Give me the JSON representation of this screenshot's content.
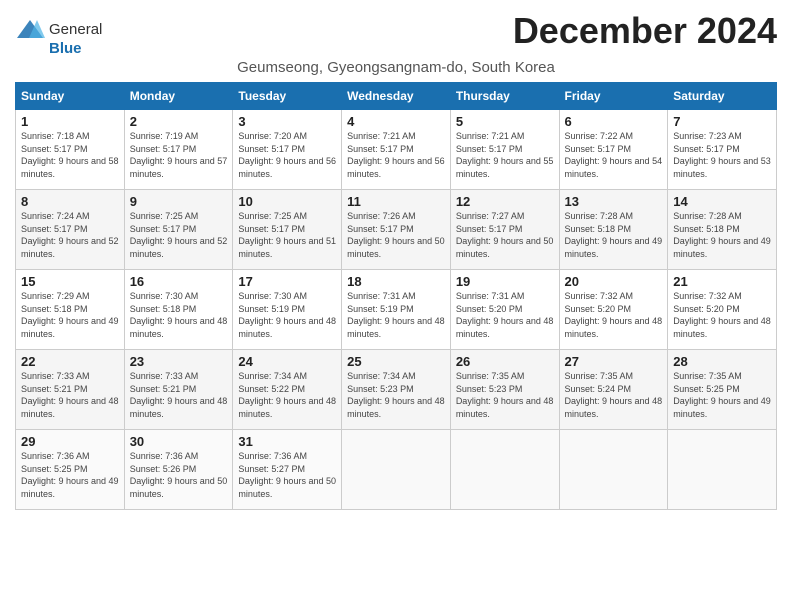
{
  "header": {
    "logo_general": "General",
    "logo_blue": "Blue",
    "month_title": "December 2024",
    "location": "Geumseong, Gyeongsangnam-do, South Korea"
  },
  "weekdays": [
    "Sunday",
    "Monday",
    "Tuesday",
    "Wednesday",
    "Thursday",
    "Friday",
    "Saturday"
  ],
  "weeks": [
    [
      {
        "day": "1",
        "sunrise": "Sunrise: 7:18 AM",
        "sunset": "Sunset: 5:17 PM",
        "daylight": "Daylight: 9 hours and 58 minutes."
      },
      {
        "day": "2",
        "sunrise": "Sunrise: 7:19 AM",
        "sunset": "Sunset: 5:17 PM",
        "daylight": "Daylight: 9 hours and 57 minutes."
      },
      {
        "day": "3",
        "sunrise": "Sunrise: 7:20 AM",
        "sunset": "Sunset: 5:17 PM",
        "daylight": "Daylight: 9 hours and 56 minutes."
      },
      {
        "day": "4",
        "sunrise": "Sunrise: 7:21 AM",
        "sunset": "Sunset: 5:17 PM",
        "daylight": "Daylight: 9 hours and 56 minutes."
      },
      {
        "day": "5",
        "sunrise": "Sunrise: 7:21 AM",
        "sunset": "Sunset: 5:17 PM",
        "daylight": "Daylight: 9 hours and 55 minutes."
      },
      {
        "day": "6",
        "sunrise": "Sunrise: 7:22 AM",
        "sunset": "Sunset: 5:17 PM",
        "daylight": "Daylight: 9 hours and 54 minutes."
      },
      {
        "day": "7",
        "sunrise": "Sunrise: 7:23 AM",
        "sunset": "Sunset: 5:17 PM",
        "daylight": "Daylight: 9 hours and 53 minutes."
      }
    ],
    [
      {
        "day": "8",
        "sunrise": "Sunrise: 7:24 AM",
        "sunset": "Sunset: 5:17 PM",
        "daylight": "Daylight: 9 hours and 52 minutes."
      },
      {
        "day": "9",
        "sunrise": "Sunrise: 7:25 AM",
        "sunset": "Sunset: 5:17 PM",
        "daylight": "Daylight: 9 hours and 52 minutes."
      },
      {
        "day": "10",
        "sunrise": "Sunrise: 7:25 AM",
        "sunset": "Sunset: 5:17 PM",
        "daylight": "Daylight: 9 hours and 51 minutes."
      },
      {
        "day": "11",
        "sunrise": "Sunrise: 7:26 AM",
        "sunset": "Sunset: 5:17 PM",
        "daylight": "Daylight: 9 hours and 50 minutes."
      },
      {
        "day": "12",
        "sunrise": "Sunrise: 7:27 AM",
        "sunset": "Sunset: 5:17 PM",
        "daylight": "Daylight: 9 hours and 50 minutes."
      },
      {
        "day": "13",
        "sunrise": "Sunrise: 7:28 AM",
        "sunset": "Sunset: 5:18 PM",
        "daylight": "Daylight: 9 hours and 49 minutes."
      },
      {
        "day": "14",
        "sunrise": "Sunrise: 7:28 AM",
        "sunset": "Sunset: 5:18 PM",
        "daylight": "Daylight: 9 hours and 49 minutes."
      }
    ],
    [
      {
        "day": "15",
        "sunrise": "Sunrise: 7:29 AM",
        "sunset": "Sunset: 5:18 PM",
        "daylight": "Daylight: 9 hours and 49 minutes."
      },
      {
        "day": "16",
        "sunrise": "Sunrise: 7:30 AM",
        "sunset": "Sunset: 5:18 PM",
        "daylight": "Daylight: 9 hours and 48 minutes."
      },
      {
        "day": "17",
        "sunrise": "Sunrise: 7:30 AM",
        "sunset": "Sunset: 5:19 PM",
        "daylight": "Daylight: 9 hours and 48 minutes."
      },
      {
        "day": "18",
        "sunrise": "Sunrise: 7:31 AM",
        "sunset": "Sunset: 5:19 PM",
        "daylight": "Daylight: 9 hours and 48 minutes."
      },
      {
        "day": "19",
        "sunrise": "Sunrise: 7:31 AM",
        "sunset": "Sunset: 5:20 PM",
        "daylight": "Daylight: 9 hours and 48 minutes."
      },
      {
        "day": "20",
        "sunrise": "Sunrise: 7:32 AM",
        "sunset": "Sunset: 5:20 PM",
        "daylight": "Daylight: 9 hours and 48 minutes."
      },
      {
        "day": "21",
        "sunrise": "Sunrise: 7:32 AM",
        "sunset": "Sunset: 5:20 PM",
        "daylight": "Daylight: 9 hours and 48 minutes."
      }
    ],
    [
      {
        "day": "22",
        "sunrise": "Sunrise: 7:33 AM",
        "sunset": "Sunset: 5:21 PM",
        "daylight": "Daylight: 9 hours and 48 minutes."
      },
      {
        "day": "23",
        "sunrise": "Sunrise: 7:33 AM",
        "sunset": "Sunset: 5:21 PM",
        "daylight": "Daylight: 9 hours and 48 minutes."
      },
      {
        "day": "24",
        "sunrise": "Sunrise: 7:34 AM",
        "sunset": "Sunset: 5:22 PM",
        "daylight": "Daylight: 9 hours and 48 minutes."
      },
      {
        "day": "25",
        "sunrise": "Sunrise: 7:34 AM",
        "sunset": "Sunset: 5:23 PM",
        "daylight": "Daylight: 9 hours and 48 minutes."
      },
      {
        "day": "26",
        "sunrise": "Sunrise: 7:35 AM",
        "sunset": "Sunset: 5:23 PM",
        "daylight": "Daylight: 9 hours and 48 minutes."
      },
      {
        "day": "27",
        "sunrise": "Sunrise: 7:35 AM",
        "sunset": "Sunset: 5:24 PM",
        "daylight": "Daylight: 9 hours and 48 minutes."
      },
      {
        "day": "28",
        "sunrise": "Sunrise: 7:35 AM",
        "sunset": "Sunset: 5:25 PM",
        "daylight": "Daylight: 9 hours and 49 minutes."
      }
    ],
    [
      {
        "day": "29",
        "sunrise": "Sunrise: 7:36 AM",
        "sunset": "Sunset: 5:25 PM",
        "daylight": "Daylight: 9 hours and 49 minutes."
      },
      {
        "day": "30",
        "sunrise": "Sunrise: 7:36 AM",
        "sunset": "Sunset: 5:26 PM",
        "daylight": "Daylight: 9 hours and 50 minutes."
      },
      {
        "day": "31",
        "sunrise": "Sunrise: 7:36 AM",
        "sunset": "Sunset: 5:27 PM",
        "daylight": "Daylight: 9 hours and 50 minutes."
      },
      null,
      null,
      null,
      null
    ]
  ]
}
